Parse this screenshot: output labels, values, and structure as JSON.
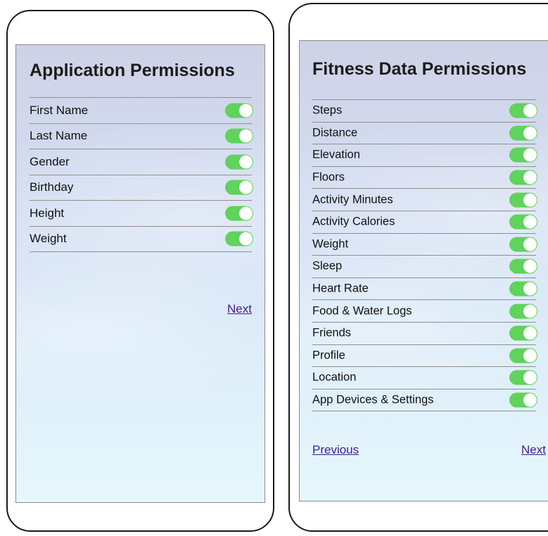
{
  "app_permissions": {
    "title": "Application Permissions",
    "items": [
      {
        "label": "First Name",
        "enabled": true
      },
      {
        "label": "Last Name",
        "enabled": true
      },
      {
        "label": "Gender",
        "enabled": true
      },
      {
        "label": "Birthday",
        "enabled": true
      },
      {
        "label": "Height",
        "enabled": true
      },
      {
        "label": "Weight",
        "enabled": true
      }
    ],
    "next_label": "Next"
  },
  "fitness_permissions": {
    "title": "Fitness Data Permissions",
    "items": [
      {
        "label": "Steps",
        "enabled": true
      },
      {
        "label": "Distance",
        "enabled": true
      },
      {
        "label": "Elevation",
        "enabled": true
      },
      {
        "label": "Floors",
        "enabled": true
      },
      {
        "label": "Activity Minutes",
        "enabled": true
      },
      {
        "label": "Activity Calories",
        "enabled": true
      },
      {
        "label": "Weight",
        "enabled": true
      },
      {
        "label": "Sleep",
        "enabled": true
      },
      {
        "label": "Heart Rate",
        "enabled": true
      },
      {
        "label": "Food & Water Logs",
        "enabled": true
      },
      {
        "label": "Friends",
        "enabled": true
      },
      {
        "label": "Profile",
        "enabled": true
      },
      {
        "label": "Location",
        "enabled": true
      },
      {
        "label": "App Devices & Settings",
        "enabled": true
      }
    ],
    "previous_label": "Previous",
    "next_label": "Next"
  },
  "colors": {
    "toggle_on": "#5fd35b",
    "link": "#3e1f8e"
  }
}
